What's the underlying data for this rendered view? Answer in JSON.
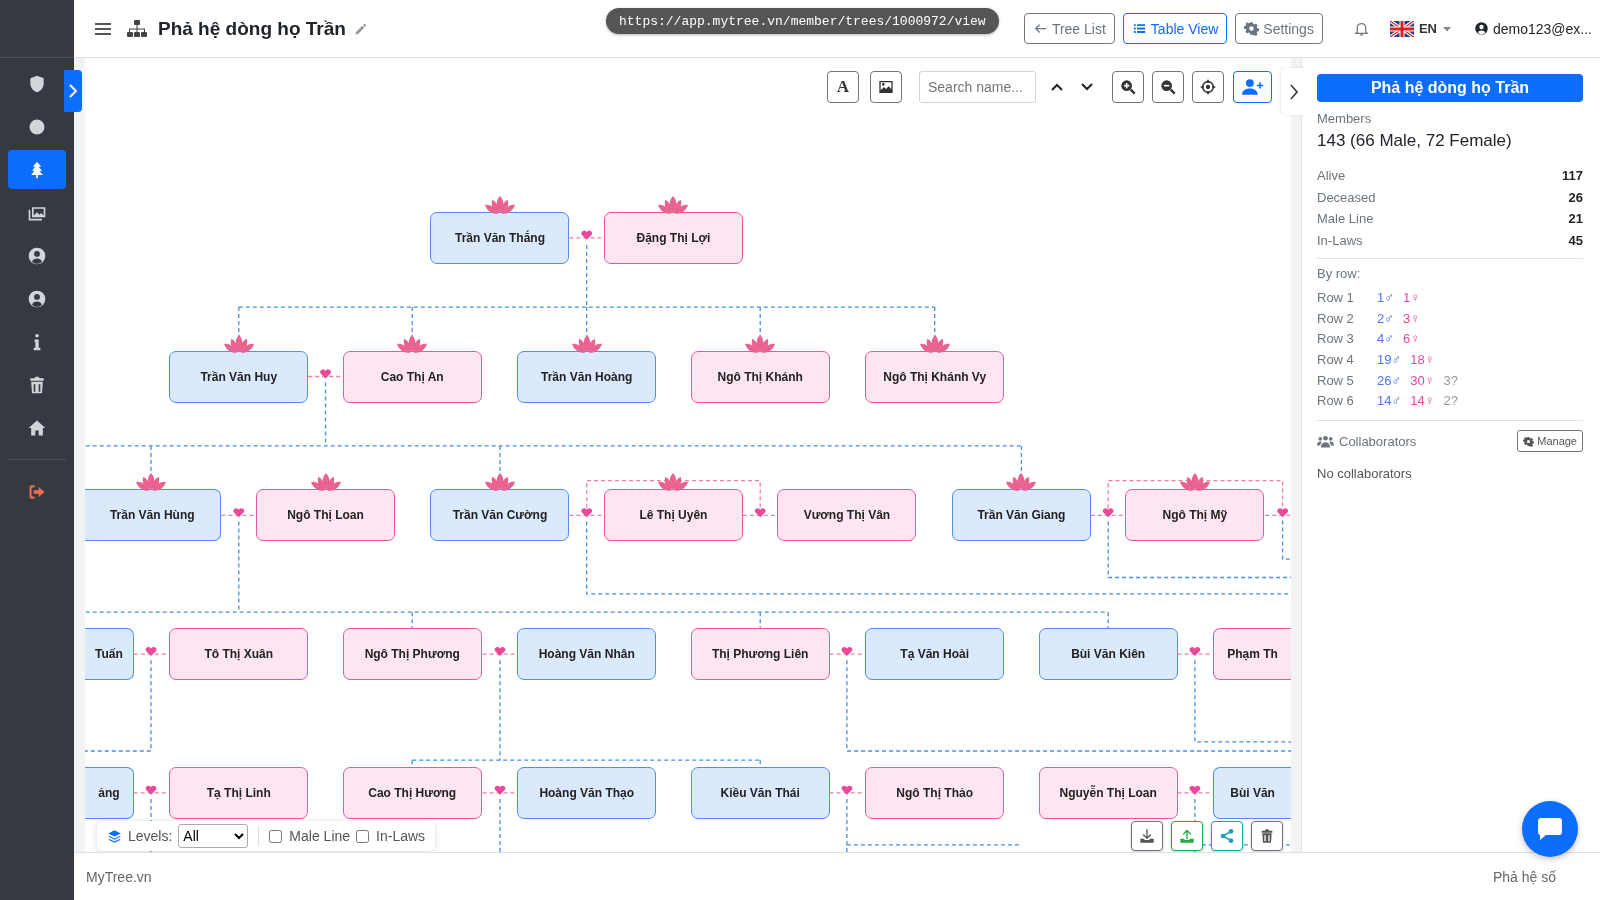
{
  "sidebar": {
    "items": [
      {
        "kind": "shield",
        "selected": false
      },
      {
        "kind": "circle",
        "selected": false
      },
      {
        "kind": "tree",
        "selected": true
      },
      {
        "kind": "images",
        "selected": false
      },
      {
        "kind": "user",
        "selected": false
      },
      {
        "kind": "user",
        "selected": false
      },
      {
        "kind": "info",
        "selected": false
      },
      {
        "kind": "trash",
        "selected": false
      },
      {
        "kind": "home",
        "selected": false
      }
    ],
    "bottom_items": [
      {
        "kind": "signout",
        "selected": false
      }
    ]
  },
  "header": {
    "title": "Phả hệ dòng họ Trần",
    "url_tooltip": "https://app.mytree.vn/member/trees/1000972/view",
    "buttons": [
      {
        "label": "Tree List",
        "kind": "back",
        "selected": false
      },
      {
        "label": "Table View",
        "kind": "table",
        "selected": true
      },
      {
        "label": "Settings",
        "kind": "settings",
        "selected": false
      }
    ],
    "language": "EN",
    "user": "demo123@ex..."
  },
  "canvas": {
    "font_button": "A",
    "search": {
      "placeholder": "Search name..."
    },
    "rows": [
      {
        "members": [
          {
            "name": "Trần Văn Thắng",
            "kind": "male",
            "lotus": true
          },
          {
            "name": "Đặng Thị Lợi",
            "kind": "female",
            "lotus": true
          }
        ]
      },
      {
        "members": [
          {
            "name": "Trần Văn Huy",
            "kind": "male",
            "lotus": true
          },
          {
            "name": "Cao Thị An",
            "kind": "female",
            "lotus": true
          },
          {
            "name": "Trần Văn Hoàng",
            "kind": "male",
            "lotus": true
          },
          {
            "name": "Ngô Thị Khánh",
            "kind": "female",
            "lotus": true
          },
          {
            "name": "Ngô Thị Khánh Vy",
            "kind": "female",
            "lotus": true
          }
        ]
      },
      {
        "members": [
          {
            "name": "Trần Văn Hùng",
            "kind": "male",
            "lotus": true
          },
          {
            "name": "Ngô Thị Loan",
            "kind": "female",
            "lotus": true
          },
          {
            "name": "Trần Văn Cường",
            "kind": "male",
            "lotus": true
          },
          {
            "name": "Lê Thị Uyên",
            "kind": "female",
            "lotus": true
          },
          {
            "name": "Vương Thị Vân",
            "kind": "female",
            "lotus": false
          },
          {
            "name": "Trần Văn Giang",
            "kind": "male",
            "lotus": true
          },
          {
            "name": "Ngô Thị Mỹ",
            "kind": "female",
            "lotus": true
          }
        ]
      },
      {
        "members": [
          {
            "name": "Tuấn",
            "kind": "male",
            "lotus": false
          },
          {
            "name": "Tô Thị Xuân",
            "kind": "female",
            "lotus": false
          },
          {
            "name": "Ngô Thị Phương",
            "kind": "female",
            "lotus": false
          },
          {
            "name": "Hoàng Văn Nhân",
            "kind": "male",
            "lotus": false
          },
          {
            "name": "Thị Phương Liên",
            "kind": "female",
            "lotus": false
          },
          {
            "name": "Tạ Văn Hoài",
            "kind": "male",
            "lotus": false
          },
          {
            "name": "Bùi Văn Kiên",
            "kind": "male",
            "lotus": false
          },
          {
            "name": "Phạm Th",
            "kind": "female",
            "lotus": false
          }
        ]
      },
      {
        "members": [
          {
            "name": "ảng",
            "kind": "male",
            "lotus": false
          },
          {
            "name": "Tạ Thị Linh",
            "kind": "female",
            "lotus": false
          },
          {
            "name": "Cao Thị Hương",
            "kind": "female",
            "lotus": false
          },
          {
            "name": "Hoàng Văn Thạo",
            "kind": "male",
            "lotus": false
          },
          {
            "name": "Kiều Văn Thái",
            "kind": "male",
            "lotus": false
          },
          {
            "name": "Ngô Thị Thảo",
            "kind": "female",
            "lotus": false
          },
          {
            "name": "Nguyễn Thị Loan",
            "kind": "female",
            "lotus": false
          },
          {
            "name": "Bùi Văn",
            "kind": "male",
            "lotus": false
          }
        ]
      }
    ],
    "levels": {
      "label": "Levels:",
      "value": "All",
      "filters": [
        {
          "label": "Male Line",
          "checked": false
        },
        {
          "label": "In-Laws",
          "checked": false
        }
      ]
    }
  },
  "panel": {
    "title": "Phả hệ dòng họ Trần",
    "members_label": "Members",
    "members_count": "143 (66 Male, 72 Female)",
    "stats": [
      {
        "label": "Alive",
        "value": "117"
      },
      {
        "label": "Deceased",
        "value": "26"
      },
      {
        "label": "Male Line",
        "value": "21"
      },
      {
        "label": "In-Laws",
        "value": "45"
      }
    ],
    "by_row_label": "By row:",
    "by_row": [
      {
        "label": "Row 1",
        "male": "1♂",
        "female": "1♀"
      },
      {
        "label": "Row 2",
        "male": "2♂",
        "female": "3♀"
      },
      {
        "label": "Row 3",
        "male": "4♂",
        "female": "6♀"
      },
      {
        "label": "Row 4",
        "male": "19♂",
        "female": "18♀"
      },
      {
        "label": "Row 5",
        "male": "26♂",
        "female": "30♀",
        "unknown": "3?"
      },
      {
        "label": "Row 6",
        "male": "14♂",
        "female": "14♀",
        "unknown": "2?"
      }
    ],
    "collaborators_label": "Collaborators",
    "manage_button": "Manage",
    "collaborators_empty": "No collaborators"
  },
  "footer": {
    "left": "MyTree.vn",
    "right": "Phả hệ số"
  }
}
